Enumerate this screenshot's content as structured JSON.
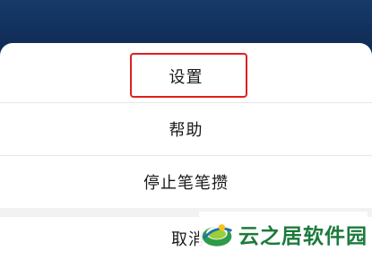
{
  "menu": {
    "items": [
      {
        "label": "设置"
      },
      {
        "label": "帮助"
      },
      {
        "label": "停止笔笔攒"
      }
    ],
    "cancel_label": "取消"
  },
  "watermark": {
    "text": "云之居软件园"
  },
  "colors": {
    "highlight": "#e02020",
    "header_bg": "#0f2a52",
    "watermark_text": "#1c7a3c"
  }
}
